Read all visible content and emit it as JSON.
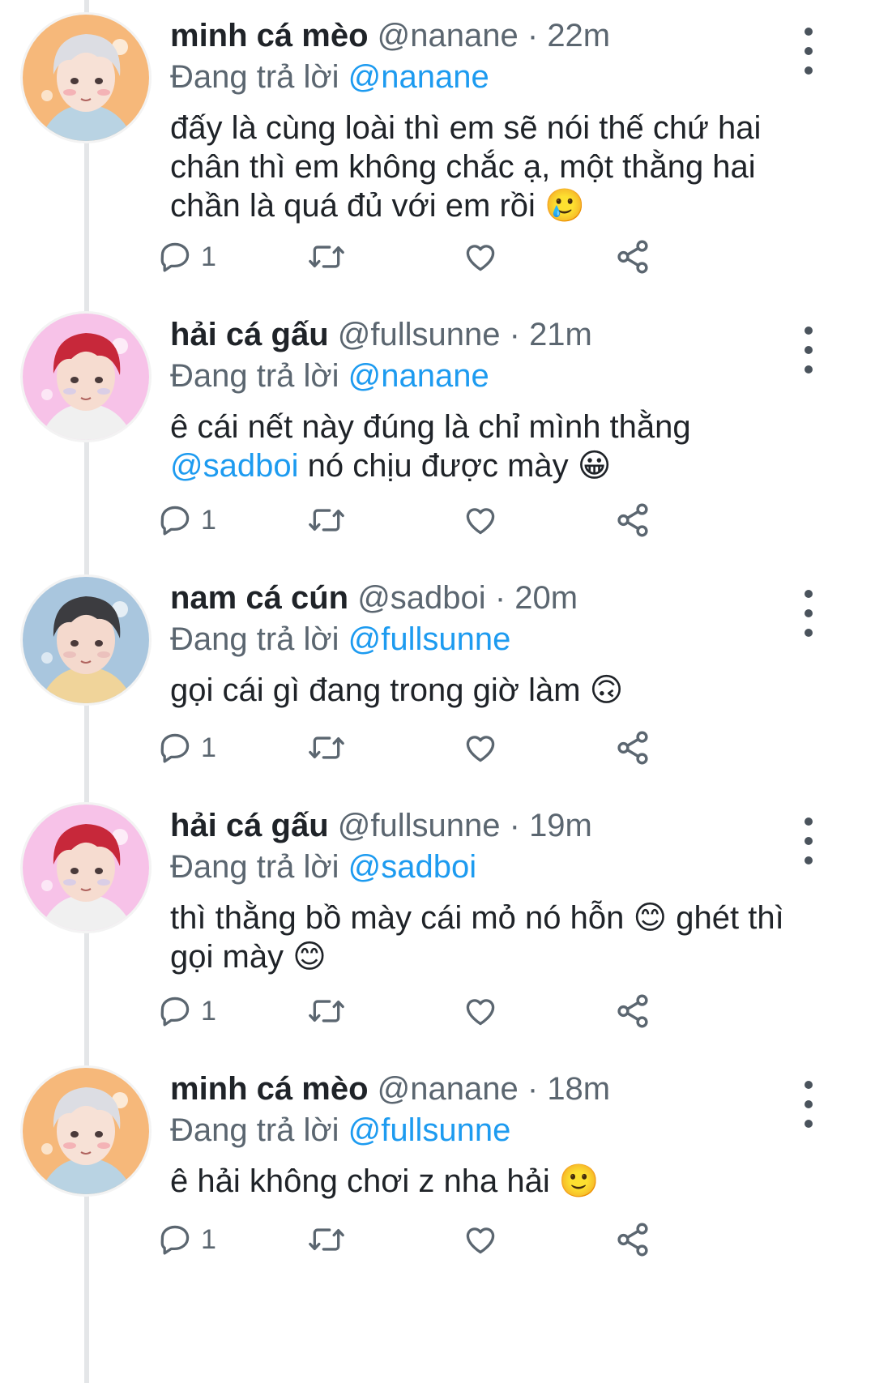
{
  "reply_prefix": "Đang trả lời",
  "tweets": [
    {
      "name": "minh cá mèo",
      "handle": "@nanane",
      "separator": "·",
      "time": "22m",
      "reply_to": "@nanane",
      "text_parts": [
        {
          "t": "đấy là cùng loài thì em sẽ nói thế chứ hai\nchân thì em không chắc ạ, một thằng hai\nchần là quá đủ với em rồi ",
          "m": false
        },
        {
          "t": "🥲",
          "m": false
        }
      ],
      "reply_count": "1",
      "avatar": "cat-boy"
    },
    {
      "name": "hải cá gấu",
      "handle": "@fullsunne",
      "separator": "·",
      "time": "21m",
      "reply_to": "@nanane",
      "text_parts": [
        {
          "t": "ê cái nết này đúng là chỉ mình thằng\n",
          "m": false
        },
        {
          "t": "@sadboi",
          "m": true
        },
        {
          "t": " nó chịu được mày ",
          "m": false
        },
        {
          "t": "😀",
          "m": false
        }
      ],
      "reply_count": "1",
      "avatar": "red-hair"
    },
    {
      "name": "nam cá cún",
      "handle": "@sadboi",
      "separator": "·",
      "time": "20m",
      "reply_to": "@fullsunne",
      "text_parts": [
        {
          "t": "gọi cái gì đang trong giờ làm ",
          "m": false
        },
        {
          "t": "🙃",
          "m": false
        }
      ],
      "reply_count": "1",
      "avatar": "dark-hair"
    },
    {
      "name": "hải cá gấu",
      "handle": "@fullsunne",
      "separator": "·",
      "time": "19m",
      "reply_to": "@sadboi",
      "text_parts": [
        {
          "t": "thì thằng bồ mày cái mỏ nó hỗn ",
          "m": false
        },
        {
          "t": "😊",
          "m": false
        },
        {
          "t": " ghét thì\ngọi mày ",
          "m": false
        },
        {
          "t": "😊",
          "m": false
        }
      ],
      "reply_count": "1",
      "avatar": "red-hair"
    },
    {
      "name": "minh cá mèo",
      "handle": "@nanane",
      "separator": "·",
      "time": "18m",
      "reply_to": "@fullsunne",
      "text_parts": [
        {
          "t": "ê hải không chơi z nha hải ",
          "m": false
        },
        {
          "t": "🙂",
          "m": false
        }
      ],
      "reply_count": "1",
      "avatar": "cat-boy"
    }
  ],
  "colors": {
    "mention": "#1d9bf0",
    "secondary_text": "#5b6670",
    "icon": "#5b6670",
    "thread_line": "#e4e6e8"
  }
}
